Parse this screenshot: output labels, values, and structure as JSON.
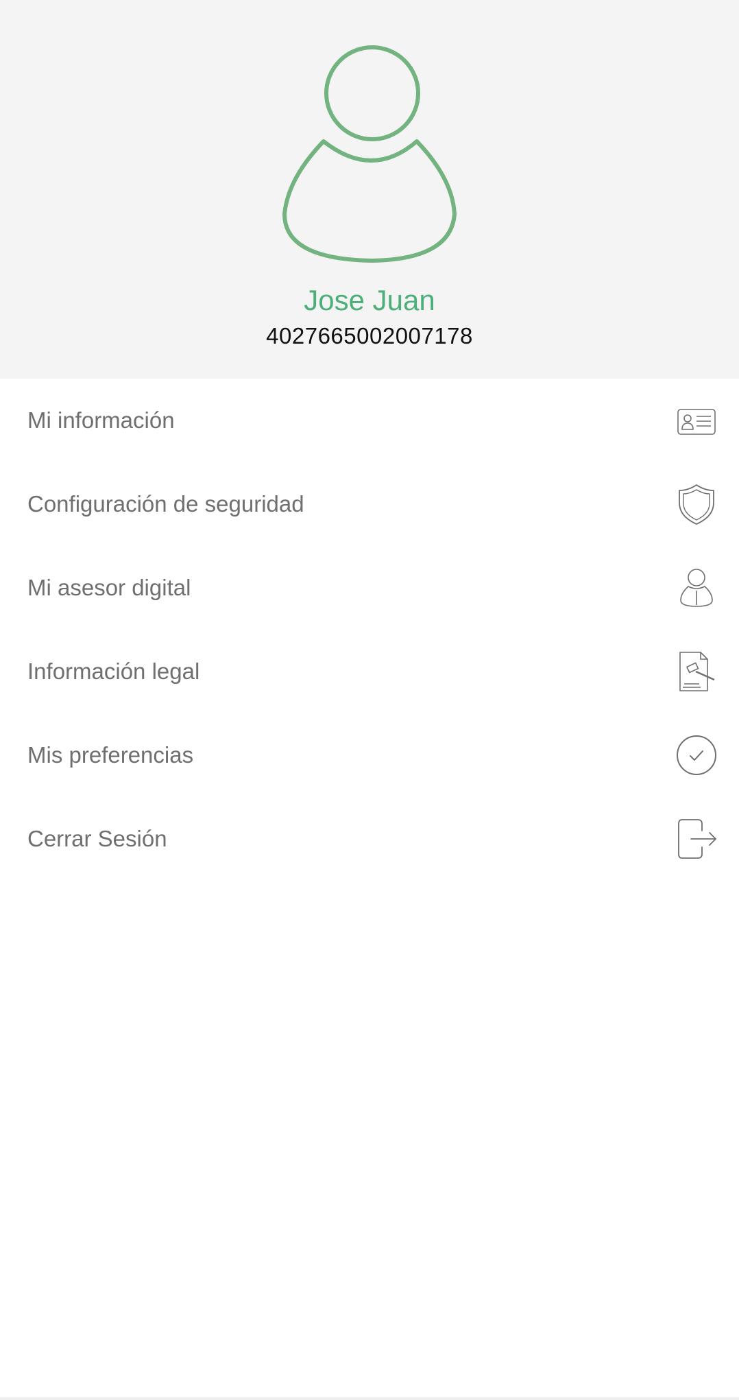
{
  "profile": {
    "name": "Jose Juan",
    "id_number": "4027665002007178",
    "accent_color": "#4caf7a",
    "avatar_icon": "user-outline-icon"
  },
  "menu": {
    "items": [
      {
        "label": "Mi información",
        "icon": "id-card-icon"
      },
      {
        "label": "Configuración de seguridad",
        "icon": "shield-icon"
      },
      {
        "label": "Mi asesor digital",
        "icon": "advisor-icon"
      },
      {
        "label": "Información legal",
        "icon": "legal-document-gavel-icon"
      },
      {
        "label": "Mis preferencias",
        "icon": "check-circle-icon"
      },
      {
        "label": "Cerrar Sesión",
        "icon": "logout-icon"
      }
    ]
  }
}
